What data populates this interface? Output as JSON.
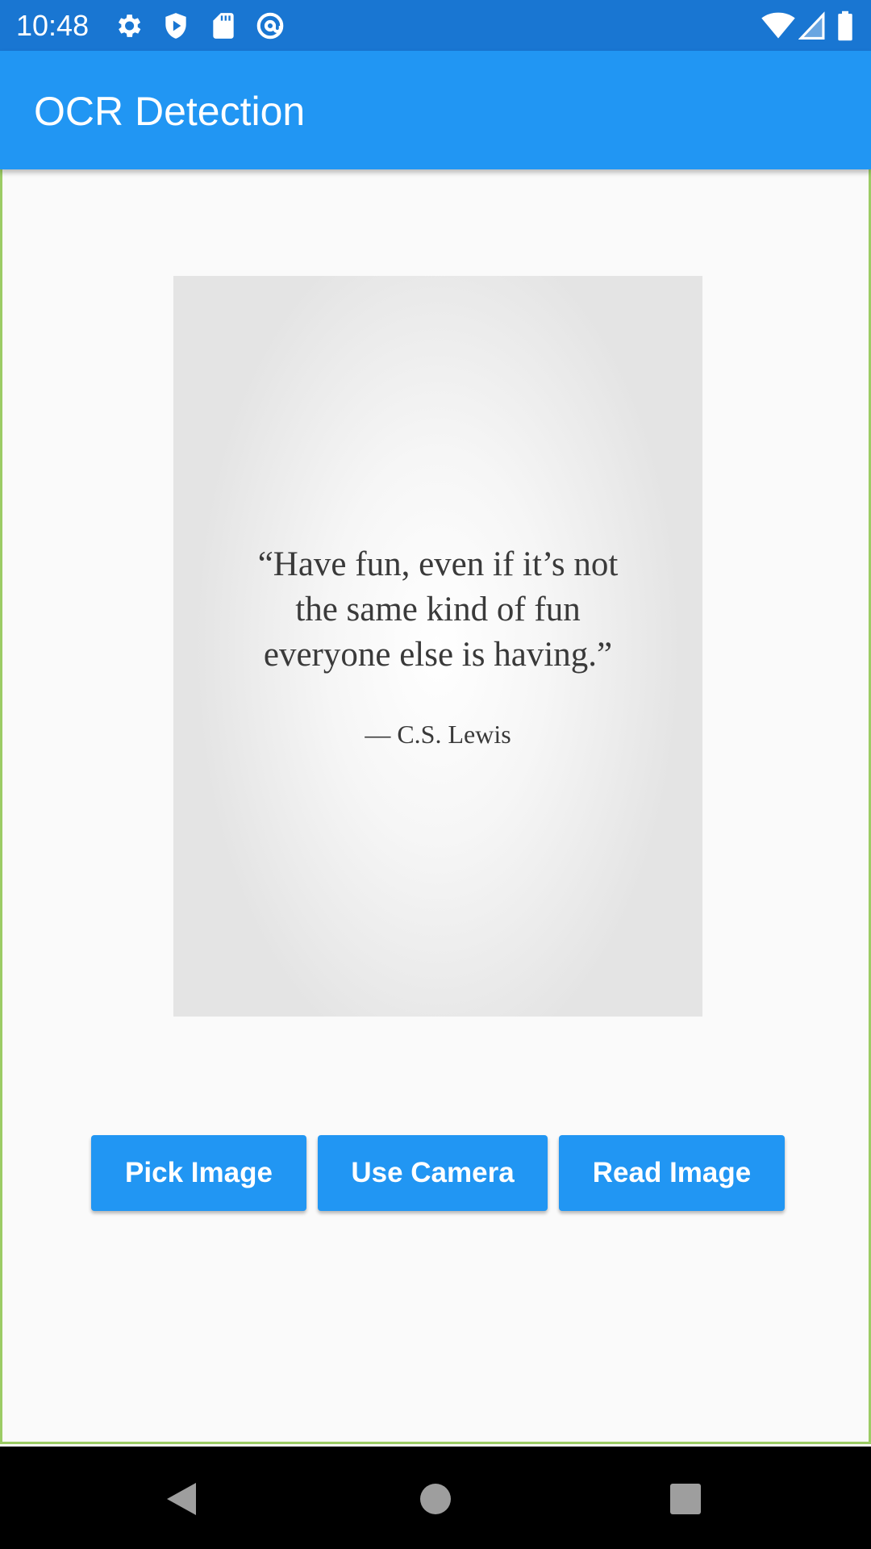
{
  "status_bar": {
    "time": "10:48",
    "icons_left": [
      "settings-icon",
      "shield-play-icon",
      "sd-card-icon",
      "at-sign-icon"
    ],
    "icons_right": [
      "wifi-icon",
      "cell-signal-icon",
      "battery-icon"
    ]
  },
  "app_bar": {
    "title": "OCR Detection"
  },
  "image_preview": {
    "quote": "“Have fun, even if it’s not\nthe same kind of fun\neveryone else is having.”",
    "author": "— C.S. Lewis"
  },
  "buttons": {
    "pick_image": "Pick Image",
    "use_camera": "Use Camera",
    "read_image": "Read Image"
  },
  "nav_bar": {
    "icons": [
      "back-icon",
      "home-icon",
      "recents-icon"
    ]
  },
  "colors": {
    "status_bar": "#1976d2",
    "primary": "#2196f3",
    "background": "#fafafa"
  }
}
